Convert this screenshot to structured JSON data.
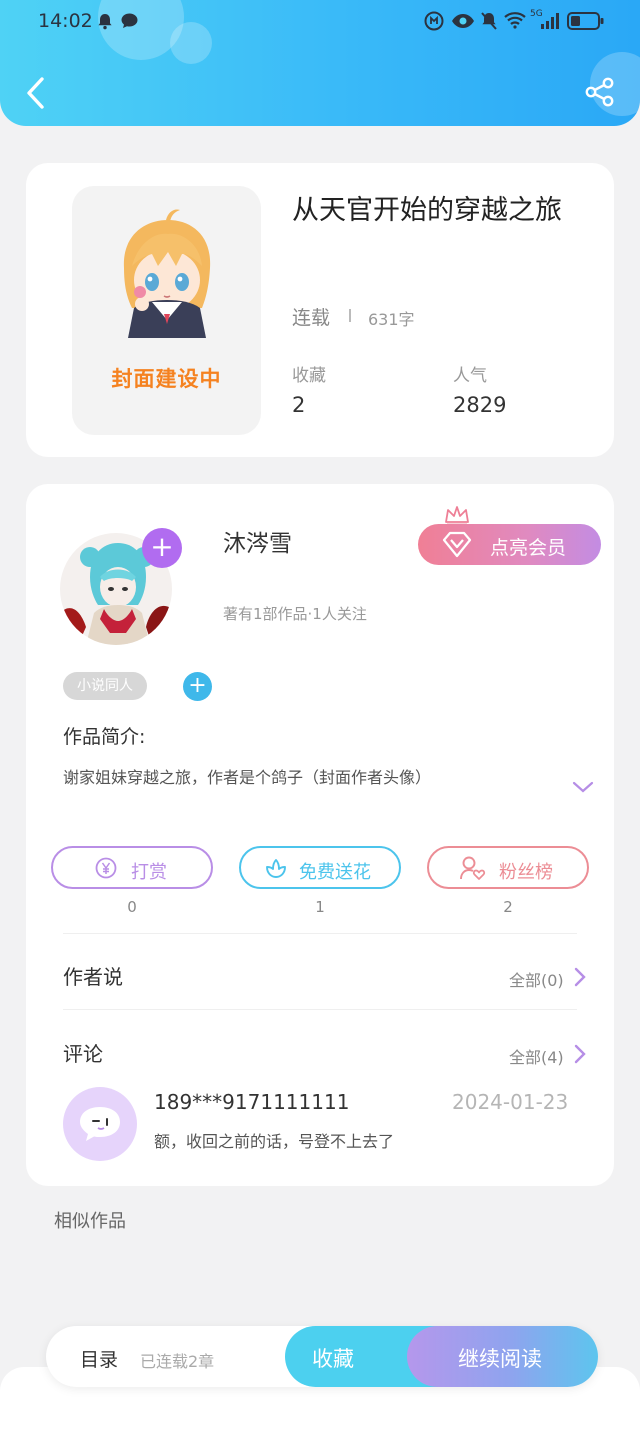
{
  "status_bar": {
    "time": "14:02",
    "network": "5G"
  },
  "book": {
    "title": "从天官开始的穿越之旅",
    "cover_text": "封面建设中",
    "status": "连载",
    "word_count": "631字",
    "stats": [
      {
        "label": "收藏",
        "value": "2"
      },
      {
        "label": "人气",
        "value": "2829"
      }
    ]
  },
  "author": {
    "name": "沐涔雪",
    "meta": "著有1部作品·1人关注",
    "vip_label": "点亮会员",
    "tag": "小说同人"
  },
  "intro": {
    "label": "作品简介:",
    "text": "谢家姐妹穿越之旅，作者是个鸽子（封面作者头像）"
  },
  "actions": [
    {
      "label": "打赏",
      "count": "0",
      "color": "#b98ee6"
    },
    {
      "label": "免费送花",
      "count": "1",
      "color": "#4cc4ec"
    },
    {
      "label": "粉丝榜",
      "count": "2",
      "color": "#ec8d95"
    }
  ],
  "author_says": {
    "title": "作者说",
    "more": "全部(0)"
  },
  "comments": {
    "title": "评论",
    "more": "全部(4)",
    "items": [
      {
        "user": "189***9171111111",
        "date": "2024-01-23",
        "text": "额，收回之前的话，号登不上去了"
      }
    ]
  },
  "similar_title": "相似作品",
  "bottom_bar": {
    "toc": "目录",
    "chapters": "已连载2章",
    "favorite": "收藏",
    "continue": "继续阅读"
  }
}
